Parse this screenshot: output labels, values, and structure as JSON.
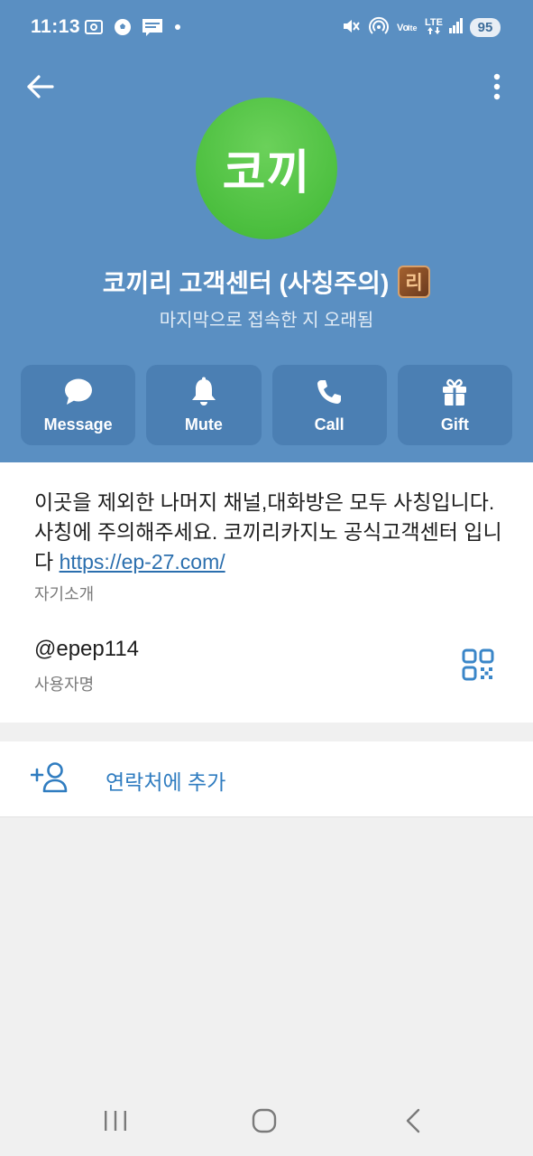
{
  "status_bar": {
    "time": "11:13",
    "battery": "95",
    "network": "LTE",
    "left_icons": [
      "screenshot-icon",
      "soccer-icon",
      "webtoon-icon",
      "dot-icon"
    ],
    "right_icons": [
      "mute-icon",
      "hotspot-icon",
      "volte-icon",
      "lte-icon",
      "signal-icon",
      "battery-icon"
    ]
  },
  "header": {
    "back_icon": "arrow-left-icon",
    "more_icon": "more-vertical-icon",
    "avatar_text": "코끼",
    "avatar_color": "#4cbf3f",
    "background_color": "#5a8fc2",
    "profile_name": "코끼리 고객센터 (사칭주의)",
    "name_emoji": "리",
    "last_seen": "마지막으로 접속한 지 오래됨"
  },
  "actions": [
    {
      "label": "Message",
      "icon": "chat-bubble-icon"
    },
    {
      "label": "Mute",
      "icon": "bell-icon"
    },
    {
      "label": "Call",
      "icon": "phone-icon"
    },
    {
      "label": "Gift",
      "icon": "gift-icon"
    }
  ],
  "info": {
    "bio_text": "이곳을 제외한 나머지 채널,대화방은 모두 사칭입니다. 사칭에 주의해주세요. 코끼리카지노 공식고객센터 입니다 ",
    "bio_link": "https://ep-27.com/",
    "bio_label": "자기소개",
    "username": "@epep114",
    "username_label": "사용자명",
    "qr_icon": "qr-code-icon",
    "link_color": "#2b6fae"
  },
  "add_contact": {
    "label": "연락처에 추가",
    "icon": "add-person-icon",
    "color": "#2f7cc0"
  },
  "navbar": {
    "icons": [
      "recent-apps-icon",
      "home-icon",
      "back-icon"
    ]
  }
}
